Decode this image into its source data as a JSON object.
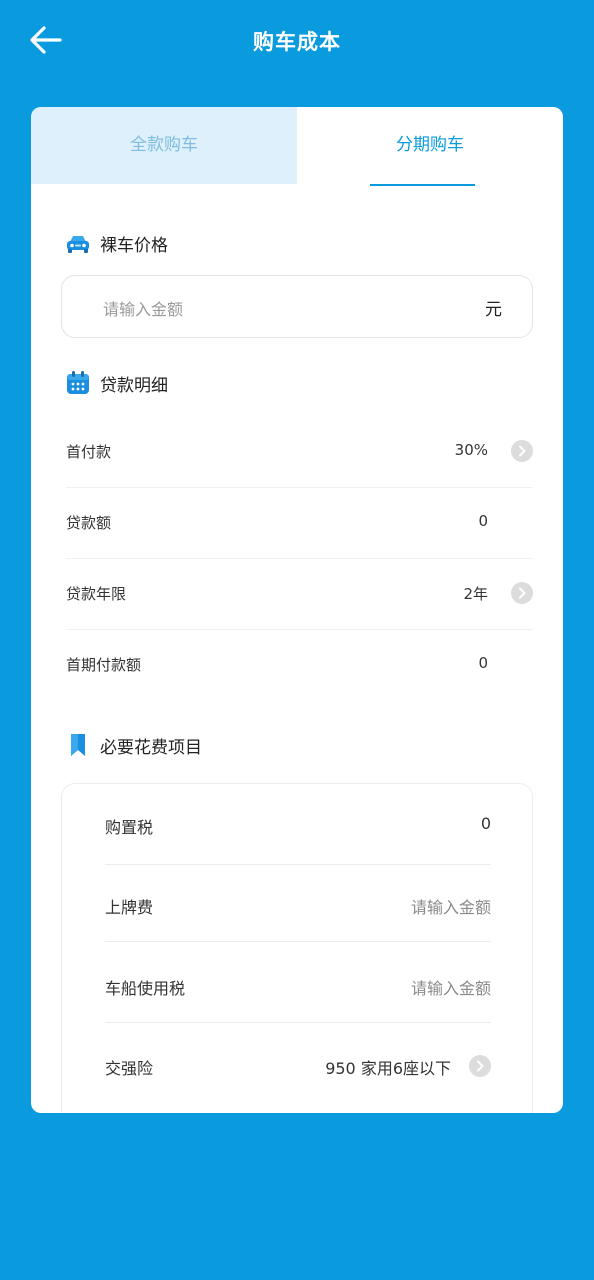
{
  "header": {
    "title": "购车成本"
  },
  "tabs": [
    {
      "label": "全款购车",
      "active": false
    },
    {
      "label": "分期购车",
      "active": true
    }
  ],
  "sections": {
    "car_price": {
      "title": "裸车价格",
      "placeholder": "请输入金额",
      "unit": "元"
    },
    "loan": {
      "title": "贷款明细",
      "rows": [
        {
          "label": "首付款",
          "value": "30%"
        },
        {
          "label": "贷款额",
          "value": "0"
        },
        {
          "label": "贷款年限",
          "value": "2年"
        },
        {
          "label": "首期付款额",
          "value": "0"
        }
      ]
    },
    "fees": {
      "title": "必要花费项目",
      "rows": [
        {
          "label": "购置税",
          "value": "0"
        },
        {
          "label": "上牌费",
          "placeholder": "请输入金额"
        },
        {
          "label": "车船使用税",
          "placeholder": "请输入金额"
        },
        {
          "label": "交强险",
          "value": "950 家用6座以下"
        }
      ]
    }
  },
  "colors": {
    "primary": "#0a9bde",
    "tab_inactive_bg": "#def0fb"
  }
}
